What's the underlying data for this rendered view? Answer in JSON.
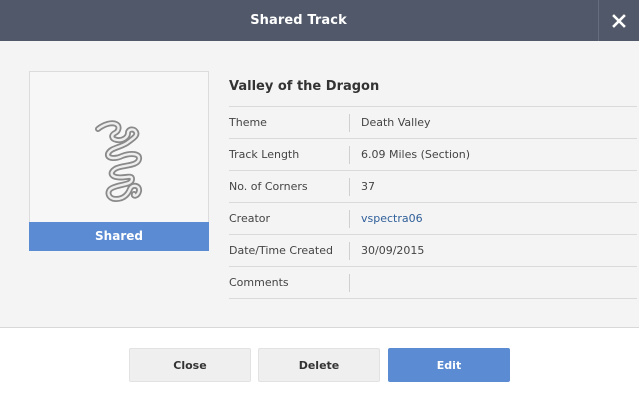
{
  "dialog": {
    "title": "Shared Track",
    "close_icon": "close-icon"
  },
  "thumbnail": {
    "status_label": "Shared",
    "status_color": "#5b8bd3",
    "track_icon": "track-outline-icon"
  },
  "track": {
    "name": "Valley of the Dragon",
    "rows": [
      {
        "label": "Theme",
        "value": "Death Valley"
      },
      {
        "label": "Track Length",
        "value": "6.09 Miles (Section)"
      },
      {
        "label": "No. of Corners",
        "value": "37"
      },
      {
        "label": "Creator",
        "value": "vspectra06"
      },
      {
        "label": "Date/Time Created",
        "value": "30/09/2015"
      },
      {
        "label": "Comments",
        "value": ""
      }
    ]
  },
  "buttons": {
    "close_label": "Close",
    "delete_label": "Delete",
    "edit_label": "Edit"
  },
  "colors": {
    "titlebar": "#505869",
    "accent": "#5b8bd3"
  }
}
